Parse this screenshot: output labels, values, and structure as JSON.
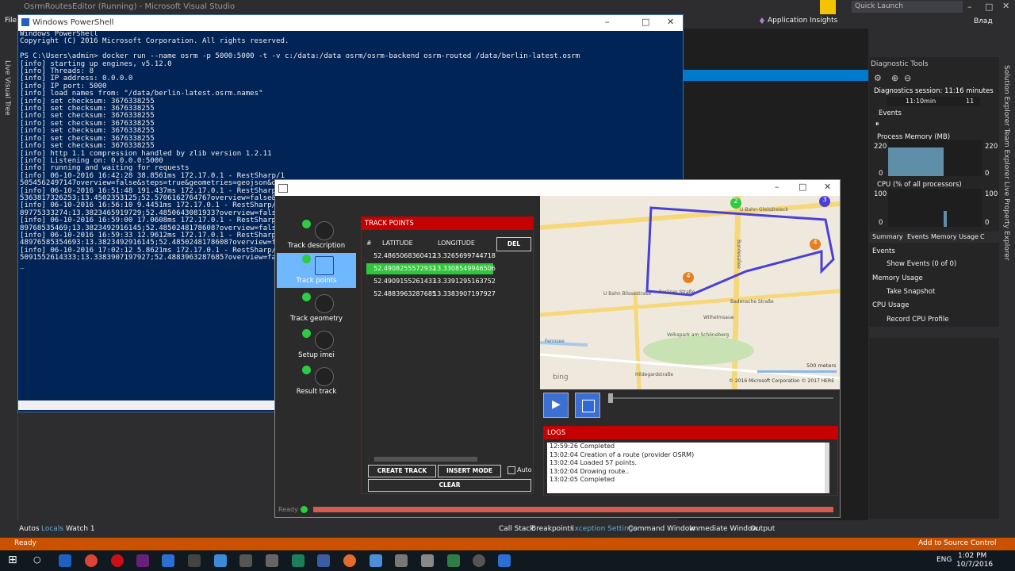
{
  "vs": {
    "title": "OsrmRoutesEditor (Running) - Microsoft Visual Studio",
    "menu_file": "File",
    "app_insights": "Application Insights",
    "quick_launch": "Quick Launch",
    "user": "Влад",
    "left_tab": "Live Visual Tree",
    "right_tabs": "Solution Explorer   Team Explorer   Live Property Explorer",
    "status": "Ready",
    "add_source": "Add to Source Control",
    "bottom_left_tabs": [
      "Autos",
      "Locals",
      "Watch 1"
    ],
    "bottom_right_tabs": [
      "Call Stack",
      "Breakpoints",
      "Exception Settings",
      "Command Window",
      "Immediate Window",
      "Output"
    ]
  },
  "diagnostics": {
    "title": "Diagnostic Tools",
    "session": "Diagnostics session: 11:16 minutes",
    "timeline_label": "11:10min",
    "timeline_right": "11",
    "events": "Events",
    "process_memory": "Process Memory (MB)",
    "mem_max_left": "220",
    "mem_max_right": "220",
    "mem_min_left": "0",
    "mem_min_right": "0",
    "cpu": "CPU (% of all processors)",
    "cpu_max_left": "100",
    "cpu_max_right": "100",
    "cpu_min_left": "0",
    "cpu_min_right": "0",
    "tabs": [
      "Summary",
      "Events",
      "Memory Usage",
      "C"
    ],
    "sections": [
      {
        "title": "Events",
        "item": "Show Events (0 of 0)"
      },
      {
        "title": "Memory Usage",
        "item": "Take Snapshot"
      },
      {
        "title": "CPU Usage",
        "item": "Record CPU Profile"
      }
    ]
  },
  "powershell": {
    "title": "Windows PowerShell",
    "lines": [
      "Windows PowerShell",
      "Copyright (C) 2016 Microsoft Corporation. All rights reserved.",
      "",
      "PS C:\\Users\\admin> docker run --name osrm -p 5000:5000 -t -v c:/data:/data osrm/osrm-backend osrm-routed /data/berlin-latest.osrm",
      "[info] starting up engines, v5.12.0",
      "[info] Threads: 8",
      "[info] IP address: 0.0.0.0",
      "[info] IP port: 5000",
      "[info] load names from: \"/data/berlin-latest.osrm.names\"",
      "[info] set checksum: 3676338255",
      "[info] set checksum: 3676338255",
      "[info] set checksum: 3676338255",
      "[info] set checksum: 3676338255",
      "[info] set checksum: 3676338255",
      "[info] set checksum: 3676338255",
      "[info] set checksum: 3676338255",
      "[info] http 1.1 compression handled by zlib version 1.2.11",
      "[info] Listening on: 0.0.0.0:5000",
      "[info] running and waiting for requests",
      "[info] 06-10-2016 16:42:28 38.8561ms 172.17.0.1 - RestSharp/1",
      "5054562497147overview=false&steps=true&geometries=geojson&ov",
      "[info] 06-10-2016 16:51:48 191.437ms 172.17.0.1 - RestSharp/1",
      "5363817326253;13.4502353125;52.5706162764767overview=false&",
      "[info] 06-10-2016 16:56:10 9.4451ms 172.17.0.1 - RestSharp/1",
      "89775333274:13.3823465919729;52.4850643081933?overview=false",
      "[info] 06-10-2016 16:59:00 17.0608ms 172.17.0.1 - RestSharp/1",
      "89768535469;13.3823492916145;52.4850248178608?overview=false",
      "[info] 06-10-2016 16:59:33 12.9612ms 172.17.0.1 - RestSharp/1",
      "48976585354693:13.3823492916145;52.4850248178608?overview=fals",
      "[info] 06-10-2016 17:02:12 5.8621ms 172.17.0.1 - RestSharp/1",
      "5091552614333;13.3383907197927;52.4883963287685?overview=fals",
      "_"
    ]
  },
  "app": {
    "steps": [
      {
        "label": "Track description",
        "icon": "clipboard-icon",
        "active": false
      },
      {
        "label": "Track points",
        "icon": "track-points-icon",
        "active": true
      },
      {
        "label": "Track geometry",
        "icon": "geometry-icon",
        "active": false
      },
      {
        "label": "Setup imei",
        "icon": "settings-icon",
        "active": false
      },
      {
        "label": "Result track",
        "icon": "globe-icon",
        "active": false
      }
    ],
    "track_points": {
      "title": "TRACK POINTS",
      "col_num": "#",
      "col_lat": "LATITUDE",
      "col_lon": "LONGITUDE",
      "del": "DEL",
      "rows": [
        {
          "lat": "52.4865068360412",
          "lon": "13.3265699744718",
          "selected": false
        },
        {
          "lat": "52.4908255572932",
          "lon": "13.3308549946506",
          "selected": true
        },
        {
          "lat": "52.4909155261433",
          "lon": "13.3391295163752",
          "selected": false
        },
        {
          "lat": "52.4883963287685",
          "lon": "13.3383907197927",
          "selected": false
        }
      ],
      "create_track": "CREATE TRACK",
      "insert_mode": "INSERT MODE",
      "auto": "Auto",
      "clear": "CLEAR"
    },
    "map": {
      "streets": [
        "U-Bahn-Gleisdreieck",
        "Bundesallee",
        "Berliner Straße",
        "Uhlandstraße",
        "Badensche Straße",
        "Wilhelmsaue",
        "U Berliner Straße",
        "U Bahn Blissestraße",
        "Fennsee",
        "Volkspark am Schöneberg",
        "Hildegardstraße",
        "U-Bahn Berliner Straße"
      ],
      "scale": "500 meters",
      "copyright": "© 2016 Microsoft Corporation   © 2017 HERE",
      "brand": "bing",
      "markers": [
        "2",
        "3",
        "4",
        "4"
      ]
    },
    "logs": {
      "title": "LOGS",
      "lines": [
        "12:59:26 Completed",
        "13:02:04 Creation of a route (provider OSRM)",
        "13:02:04 Loaded 57 points.",
        "13:02:04 Drowing route..",
        "13:02:05 Completed"
      ]
    },
    "status": "Ready"
  },
  "taskbar": {
    "time": "1:02 PM",
    "date": "10/7/2016",
    "lang": "ENG"
  }
}
